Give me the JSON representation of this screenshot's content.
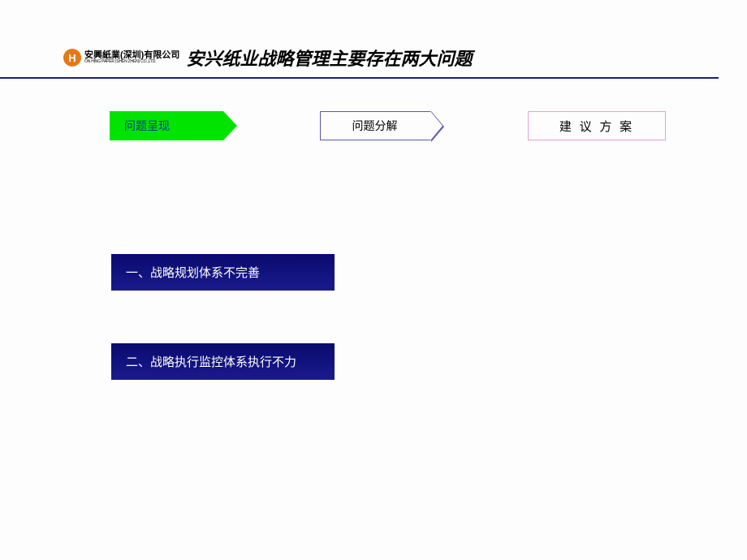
{
  "header": {
    "logo_letter": "H",
    "logo_cn": "安興紙業(深圳)有限公司",
    "logo_en": "ON HING PAPER (SHEN ZHEN) CO.,LTD.",
    "title": "安兴纸业战略管理主要存在两大问题"
  },
  "tabs": {
    "tab1": "问题呈现",
    "tab2": "问题分解",
    "tab3": "建 议 方 案"
  },
  "issues": {
    "item1": "一、战略规划体系不完善",
    "item2": "二、战略执行监控体系执行不力"
  }
}
